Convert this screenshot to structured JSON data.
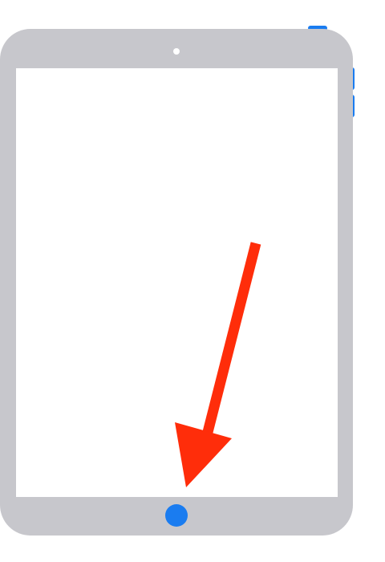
{
  "device": {
    "type": "iPad",
    "body_color": "#c7c7cc",
    "screen_color": "#ffffff",
    "highlight_color": "#1a7cf0"
  },
  "highlighted_controls": [
    "home-button",
    "top-button",
    "volume-up-button",
    "volume-down-button"
  ],
  "annotation": {
    "shape": "arrow",
    "color": "#ff2d0a",
    "points_to": "home-button"
  }
}
